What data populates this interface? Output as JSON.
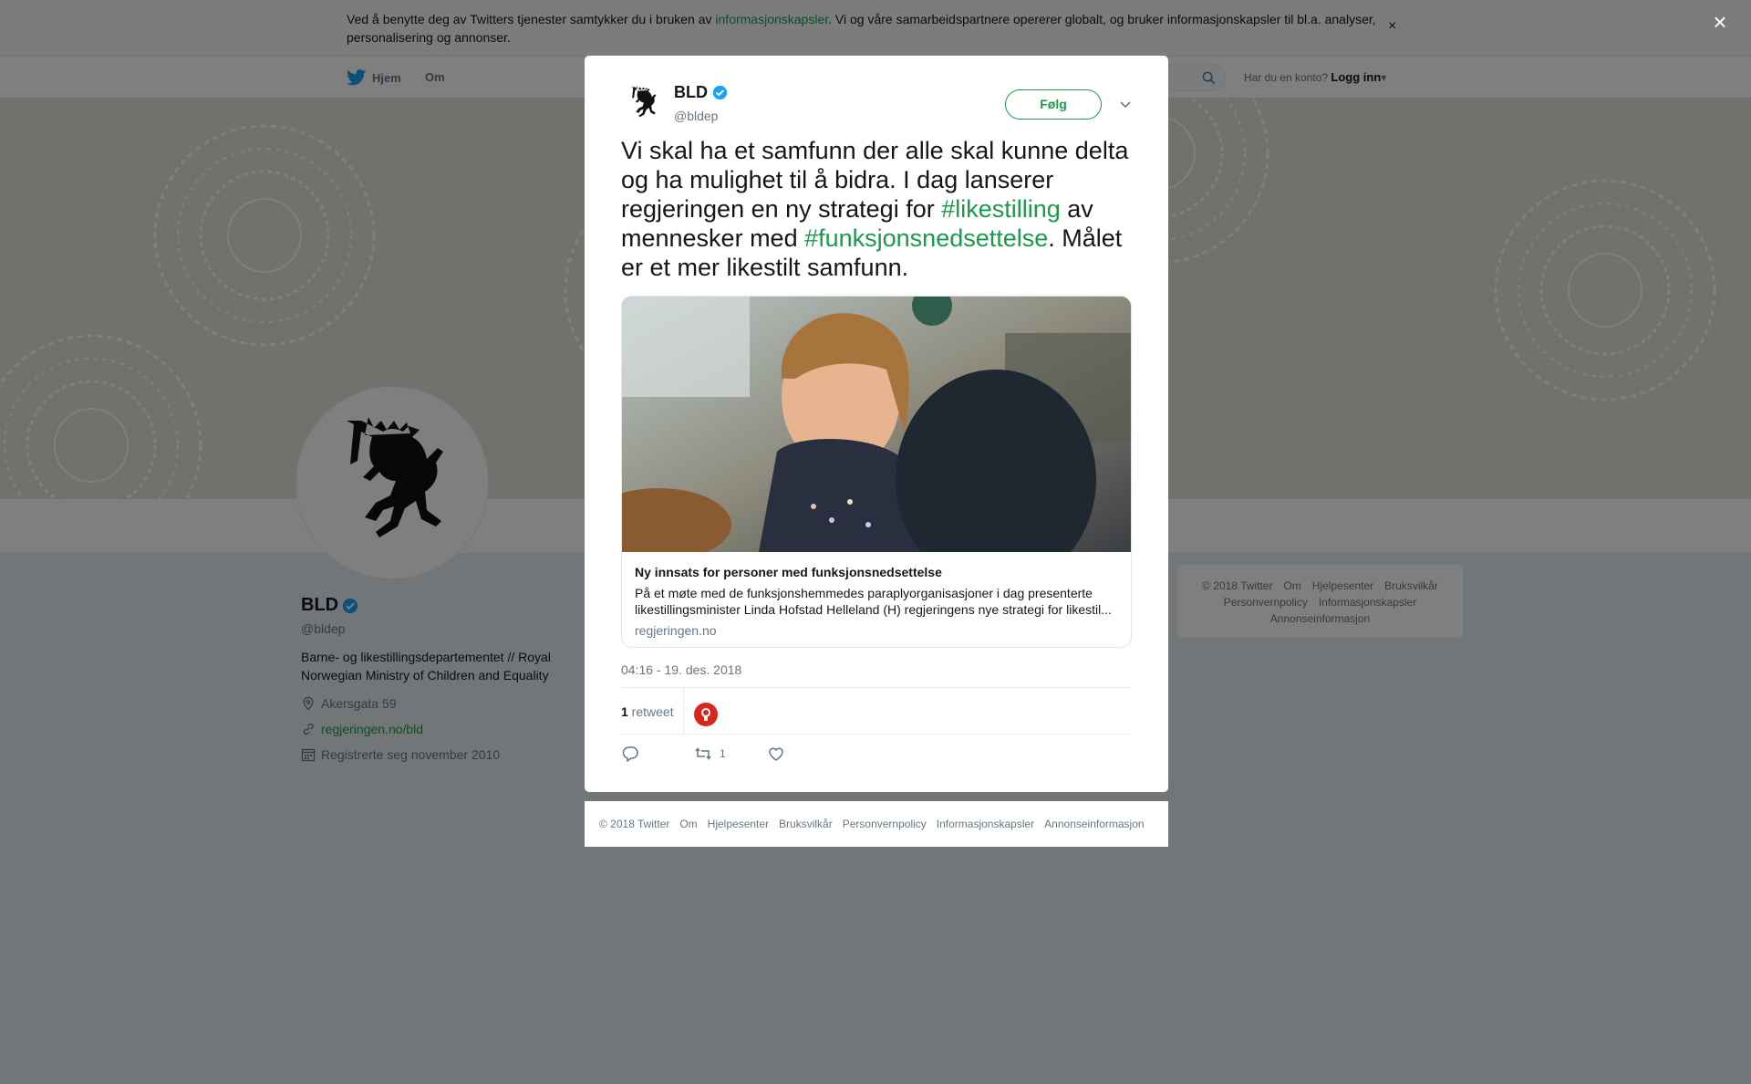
{
  "cookie": {
    "text_before": "Ved å benytte deg av Twitters tjenester samtykker du i bruken av ",
    "link": "informasjonskapsler",
    "text_after": ". Vi og våre samarbeidspartnere opererer globalt, og bruker informasjonskapsler til bl.a. analyser, personalisering og annonser.",
    "close": "×"
  },
  "nav": {
    "home": "Hjem",
    "about": "Om",
    "account_prompt": "Har du en konto?",
    "login": "Logg inn"
  },
  "profile": {
    "name": "BLD",
    "handle": "@bldep",
    "bio": "Barne- og likestillingsdepartementet // Royal Norwegian Ministry of Children and Equality",
    "location": "Akersgata 59",
    "url": "regjeringen.no/bld",
    "joined": "Registrerte seg november 2010"
  },
  "side_footer": {
    "links": [
      "© 2018 Twitter",
      "Om",
      "Hjelpesenter",
      "Bruksvilkår",
      "Personvernpolicy",
      "Informasjonskapsler",
      "Annonseinformasjon"
    ]
  },
  "overlay": {
    "close": "×"
  },
  "tweet": {
    "name": "BLD",
    "handle": "@bldep",
    "follow": "Følg",
    "text_1": "Vi skal ha et samfunn der alle skal kunne delta og ha mulighet til å bidra. I dag lanserer regjeringen en ny strategi for ",
    "hashtag_1": "#likestilling",
    "text_2": " av mennesker med ",
    "hashtag_2": "#funksjonsnedsettelse",
    "text_3": ". Målet er et mer likestilt samfunn.",
    "card": {
      "title": "Ny innsats for personer med funksjonsnedsettelse",
      "description": "På et møte med de funksjonshemmedes paraplyorganisasjoner i dag presenterte likestillingsminister Linda Hofstad Helleland (H) regjeringens nye strategi for likestil...",
      "domain": "regjeringen.no"
    },
    "timestamp": "04:16 - 19. des. 2018",
    "retweet_count": "1",
    "retweet_label": " retweet",
    "action_retweet_count": "1"
  },
  "modal_footer": {
    "links": [
      "© 2018 Twitter",
      "Om",
      "Hjelpesenter",
      "Bruksvilkår",
      "Personvernpolicy",
      "Informasjonskapsler",
      "Annonseinformasjon"
    ]
  },
  "colors": {
    "link": "#1b9a4a",
    "verified": "#1da1f2",
    "twitter_blue": "#1da1f2",
    "overlay": "rgba(0,0,0,0.5)"
  },
  "icons": {
    "home": "twitter-bird-icon",
    "search": "search-icon",
    "verified": "verified-badge-icon",
    "location": "location-pin-icon",
    "link": "link-icon",
    "calendar": "calendar-icon",
    "caret": "chevron-down-icon",
    "reply": "reply-icon",
    "retweet": "retweet-icon",
    "like": "heart-icon"
  }
}
